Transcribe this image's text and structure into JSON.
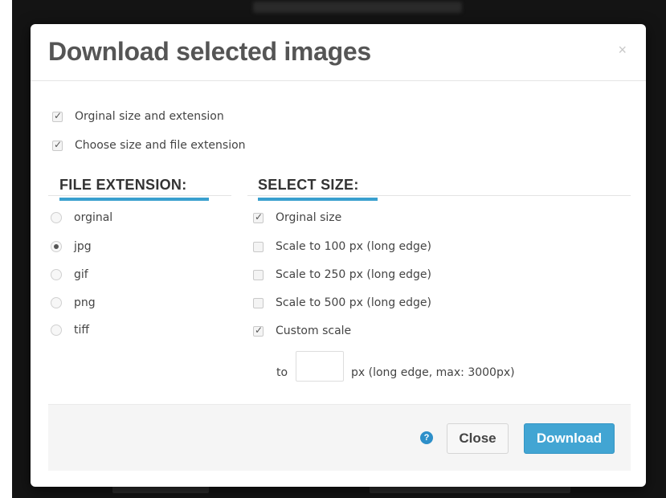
{
  "dialog": {
    "title": "Download selected images",
    "close_symbol": "×"
  },
  "options": {
    "original": {
      "label": "Orginal size and extension",
      "checked": true
    },
    "choose": {
      "label": "Choose size and file extension",
      "checked": true
    }
  },
  "file_extension": {
    "heading": "FILE EXTENSION:",
    "items": [
      {
        "label": "orginal",
        "selected": false
      },
      {
        "label": "jpg",
        "selected": true
      },
      {
        "label": "gif",
        "selected": false
      },
      {
        "label": "png",
        "selected": false
      },
      {
        "label": "tiff",
        "selected": false
      }
    ]
  },
  "select_size": {
    "heading": "SELECT SIZE:",
    "items": [
      {
        "label": "Orginal size",
        "checked": true
      },
      {
        "label": "Scale to 100 px (long edge)",
        "checked": false
      },
      {
        "label": "Scale to 250 px (long edge)",
        "checked": false
      },
      {
        "label": "Scale to 500 px (long edge)",
        "checked": false
      },
      {
        "label": "Custom scale",
        "checked": true
      }
    ],
    "custom": {
      "prefix": "to",
      "value": "",
      "suffix": "px (long edge, max: 3000px)"
    }
  },
  "footer": {
    "help_icon": "question-circle-icon",
    "help_symbol": "?",
    "close_label": "Close",
    "download_label": "Download"
  },
  "colors": {
    "accent": "#42a5d3",
    "heading_underline": "#3aa0cf"
  }
}
